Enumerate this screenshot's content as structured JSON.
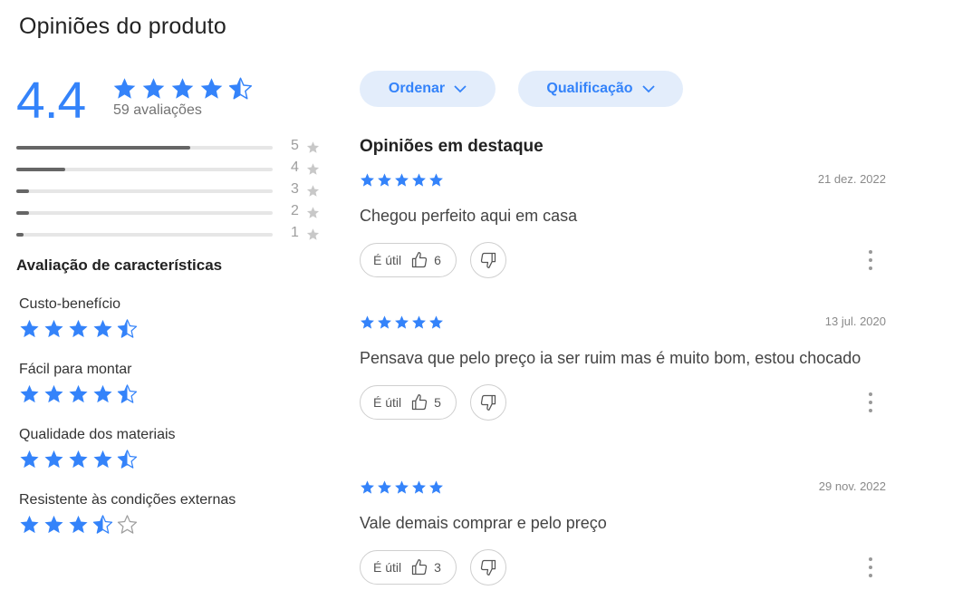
{
  "page": {
    "title": "Opiniões do produto"
  },
  "summary": {
    "average": "4.4",
    "average_value": 4.4,
    "count_label": "59 avaliações",
    "star_color": "#3483fa",
    "distribution": [
      {
        "label": "5",
        "fraction": 0.68
      },
      {
        "label": "4",
        "fraction": 0.19
      },
      {
        "label": "3",
        "fraction": 0.05
      },
      {
        "label": "2",
        "fraction": 0.05
      },
      {
        "label": "1",
        "fraction": 0.03
      }
    ]
  },
  "features": {
    "title": "Avaliação de características",
    "items": [
      {
        "label": "Custo-benefício",
        "rating": 4.5
      },
      {
        "label": "Fácil para montar",
        "rating": 4.5
      },
      {
        "label": "Qualidade dos materiais",
        "rating": 4.5
      },
      {
        "label": "Resistente às condições externas",
        "rating": 3.5
      }
    ]
  },
  "filters": {
    "sort_label": "Ordenar",
    "rating_label": "Qualificação",
    "accent_color": "#3483fa",
    "pill_bg": "#e3edfb"
  },
  "reviews": {
    "title": "Opiniões em destaque",
    "useful_label": "É útil",
    "items": [
      {
        "rating": 5,
        "date": "21 dez. 2022",
        "text": "Chegou perfeito aqui em casa",
        "useful_count": "6"
      },
      {
        "rating": 5,
        "date": "13 jul. 2020",
        "text": "Pensava que pelo preço ia ser ruim mas é muito bom, estou chocado",
        "useful_count": "5"
      },
      {
        "rating": 5,
        "date": "29 nov. 2022",
        "text": "Vale demais comprar e pelo preço",
        "useful_count": "3"
      }
    ]
  }
}
